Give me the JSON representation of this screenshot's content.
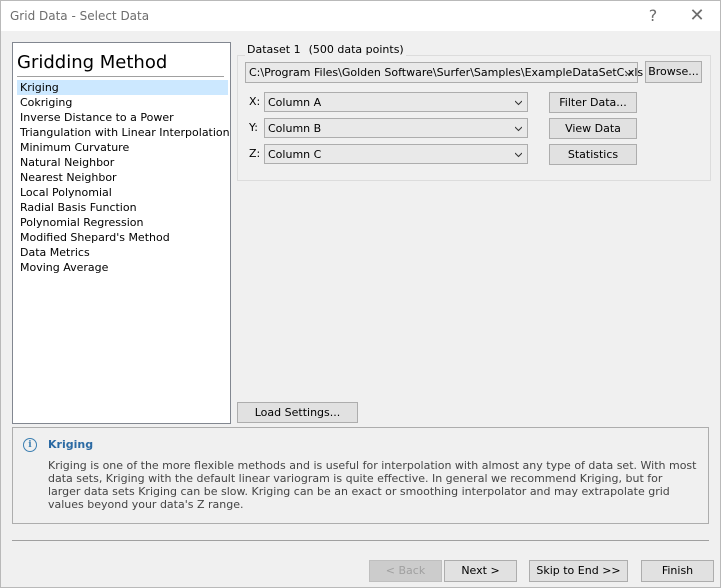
{
  "window": {
    "title": "Grid Data - Select Data",
    "help_glyph": "?",
    "close_glyph": "✕"
  },
  "methods": {
    "heading": "Gridding Method",
    "selected_index": 0,
    "items": [
      "Kriging",
      "Cokriging",
      "Inverse Distance to a Power",
      "Triangulation with Linear Interpolation",
      "Minimum Curvature",
      "Natural Neighbor",
      "Nearest Neighbor",
      "Local Polynomial",
      "Radial Basis Function",
      "Polynomial Regression",
      "Modified Shepard's Method",
      "Data Metrics",
      "Moving Average"
    ]
  },
  "dataset": {
    "label": "Dataset 1",
    "count": "(500 data points)",
    "file": "C:\\Program Files\\Golden Software\\Surfer\\Samples\\ExampleDataSetC.xls",
    "browse": "Browse...",
    "x_label": "X:",
    "x_value": "Column A",
    "y_label": "Y:",
    "y_value": "Column B",
    "z_label": "Z:",
    "z_value": "Column C",
    "filter": "Filter Data...",
    "view": "View Data",
    "statistics": "Statistics"
  },
  "load_settings": "Load Settings...",
  "info": {
    "icon": "i",
    "title": "Kriging",
    "text": "Kriging is one of the more flexible methods and is useful for interpolation with almost any type of data set. With most data sets, Kriging with the default linear variogram is quite effective. In general we recommend Kriging, but for larger data sets Kriging can be slow. Kriging can be an exact or smoothing interpolator and may extrapolate grid values beyond your data's Z range."
  },
  "footer": {
    "back": "< Back",
    "next": "Next >",
    "skip": "Skip to End >>",
    "finish": "Finish"
  }
}
